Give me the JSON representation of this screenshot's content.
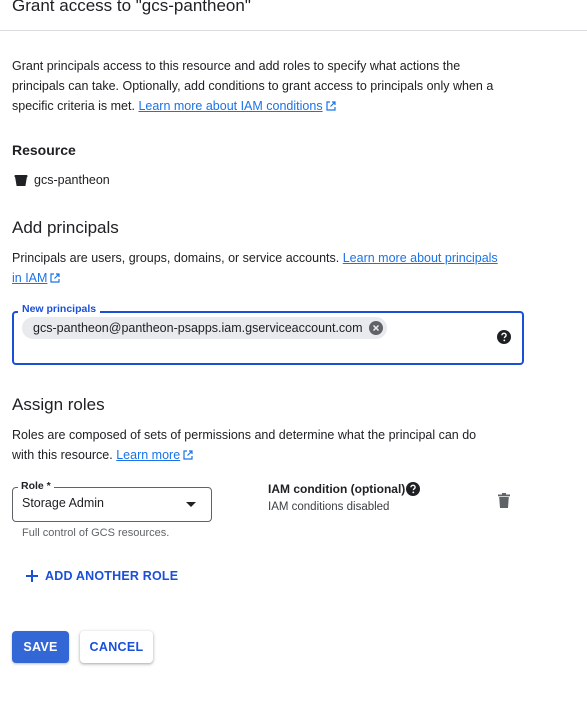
{
  "header": {
    "title": "Grant access to \"gcs-pantheon\""
  },
  "intro": {
    "line1": "Grant principals access to this resource and add roles to specify what actions the",
    "line2": "principals can take. Optionally, add conditions to grant access to principals only when a",
    "line3": "specific criteria is met.",
    "link": "Learn more about IAM conditions"
  },
  "resource": {
    "label": "Resource",
    "name": "gcs-pantheon",
    "icon": "bucket-icon"
  },
  "add_principals": {
    "title": "Add principals",
    "desc": "Principals are users, groups, domains, or service accounts.",
    "link_line1": "Learn more about principals",
    "link_line2": "in IAM",
    "field_label": "New principals",
    "chip": "gcs-pantheon@pantheon-psapps.iam.gserviceaccount.com"
  },
  "assign_roles": {
    "title": "Assign roles",
    "line1": "Roles are composed of sets of permissions and determine what the principal can do",
    "line2": "with this resource.",
    "link": "Learn more",
    "role_label": "Role *",
    "role_value": "Storage Admin",
    "role_hint": "Full control of GCS resources.",
    "condition_label": "IAM condition (optional)",
    "condition_value": "IAM conditions disabled",
    "add_another_role": "ADD ANOTHER ROLE"
  },
  "actions": {
    "save": "SAVE",
    "cancel": "CANCEL"
  },
  "colors": {
    "primary": "#1a73e8",
    "focus": "#1a4fd8",
    "button": "#3367d6"
  }
}
